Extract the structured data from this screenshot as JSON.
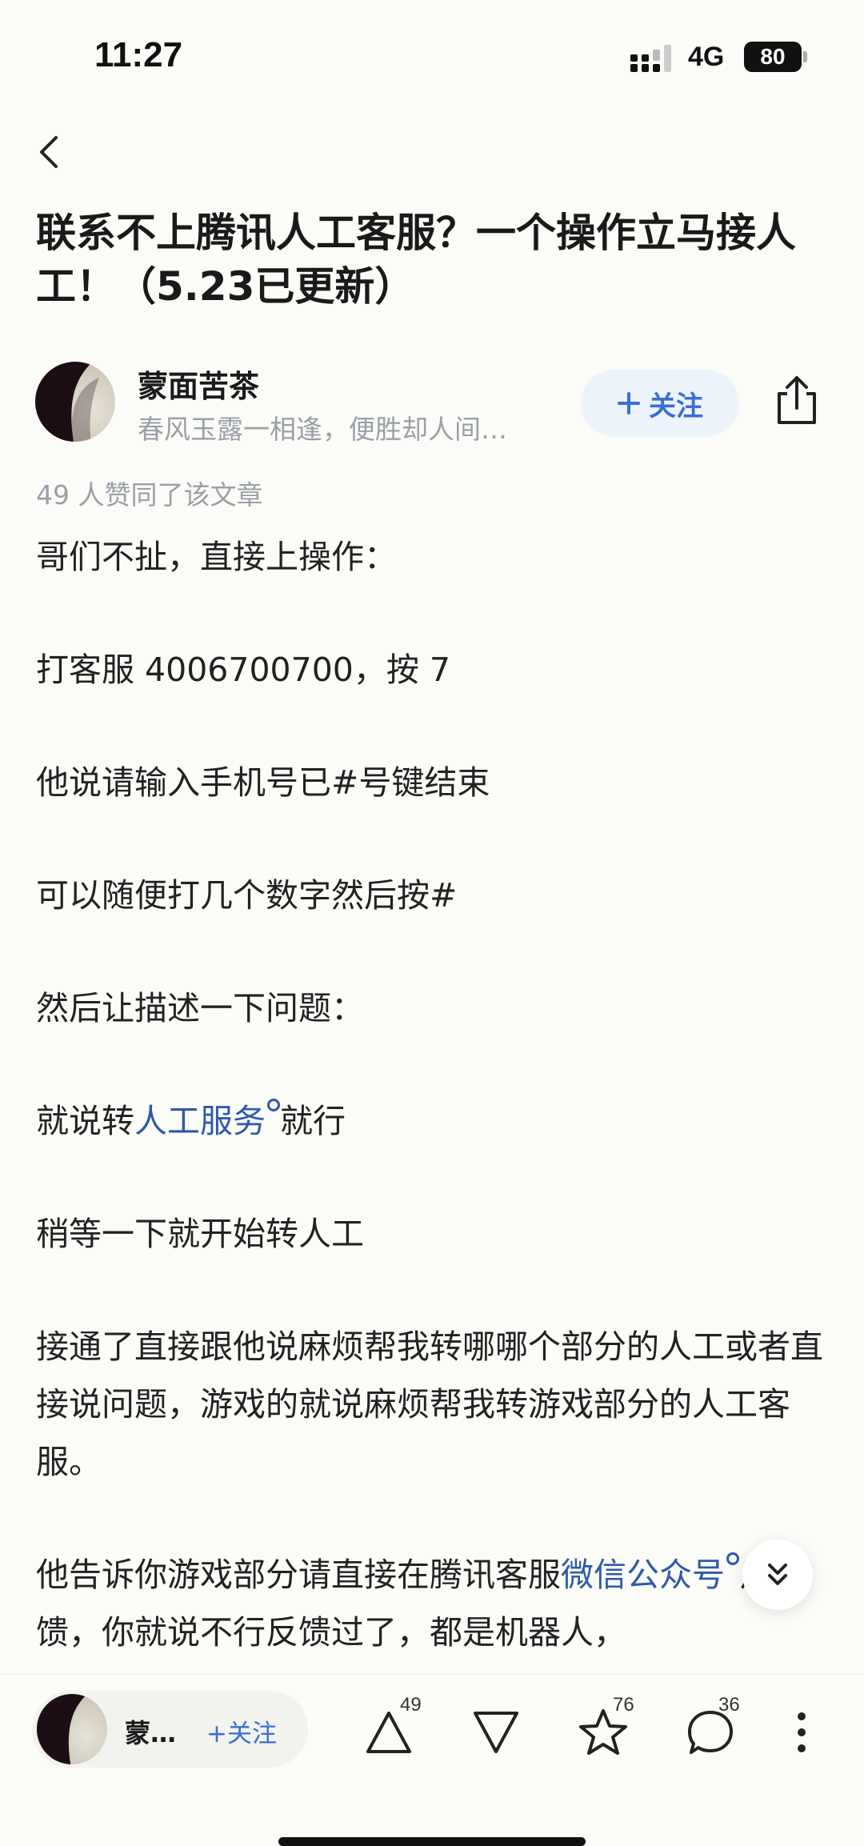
{
  "status_bar": {
    "time": "11:27",
    "network": "4G",
    "battery": "80"
  },
  "article": {
    "title": "联系不上腾讯人工客服？一个操作立马接人工！（5.23已更新）",
    "author": {
      "name": "蒙面苦茶",
      "bio": "春风玉露一相逢，便胜却人间…"
    },
    "follow_label": "关注",
    "like_summary": "49 人赞同了该文章",
    "paragraphs": {
      "p1": "哥们不扯，直接上操作：",
      "p2": "打客服 4006700700，按 7",
      "p3": "他说请输入手机号已#号键结束",
      "p4": "可以随便打几个数字然后按#",
      "p5": "然后让描述一下问题：",
      "p6_before": "就说转",
      "p6_link": "人工服务",
      "p6_after": "就行",
      "p7": "稍等一下就开始转人工",
      "p8": "接通了直接跟他说麻烦帮我转哪哪个部分的人工或者直接说问题，游戏的就说麻烦帮我转游戏部分的人工客服。",
      "p9_before": "他告诉你游戏部分请直接在腾讯客服",
      "p9_link": "微信公众号",
      "p9_after": "反馈，你就说不行反馈过了，都是机器人，"
    }
  },
  "bottom_bar": {
    "author_short": "蒙…",
    "follow_label": "+关注",
    "upvote_count": "49",
    "favorite_count": "76",
    "comment_count": "36"
  },
  "colors": {
    "background": "#fbfbf8",
    "accent": "#3b6fd3",
    "link": "#2f5aa8",
    "muted": "#9aa0a6"
  }
}
